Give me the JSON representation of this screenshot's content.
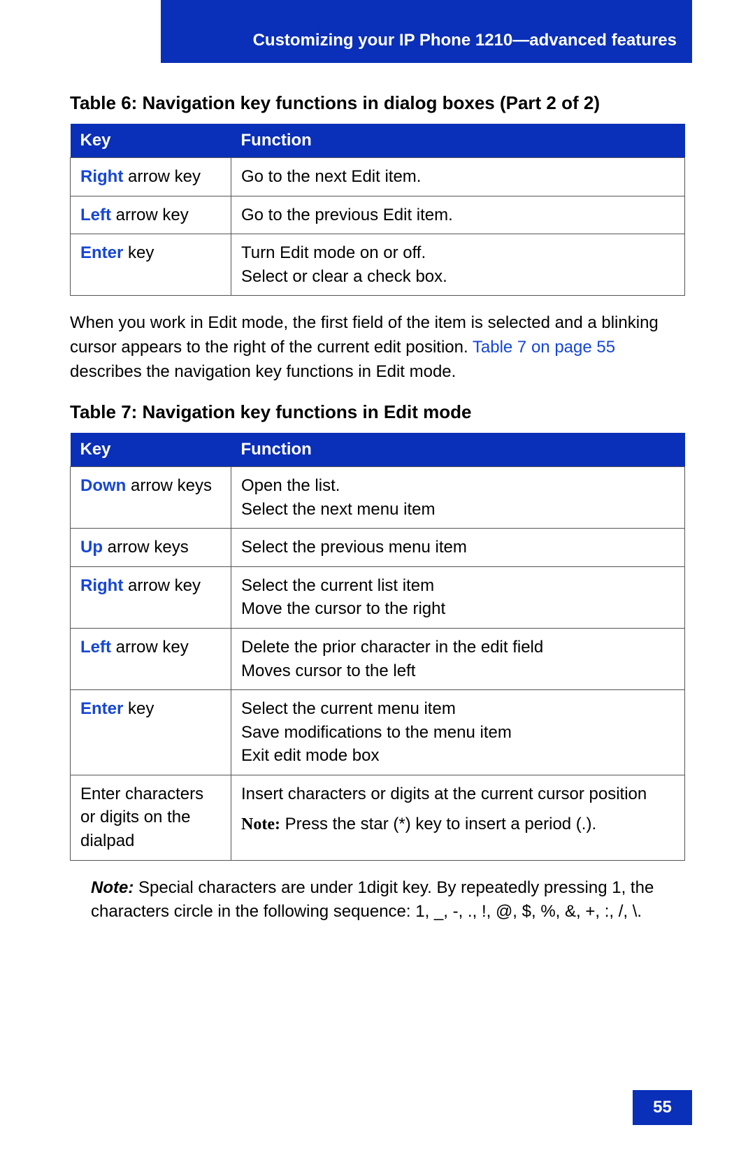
{
  "header": "Customizing your IP Phone 1210—advanced features",
  "table6": {
    "caption": "Table 6: Navigation key functions in dialog boxes (Part 2 of 2)",
    "col1": "Key",
    "col2": "Function",
    "rows": [
      {
        "kb": "Right",
        "kt": " arrow key",
        "fn": "Go to the next Edit item."
      },
      {
        "kb": "Left",
        "kt": " arrow key",
        "fn": "Go to the previous Edit item."
      },
      {
        "kb": "Enter",
        "kt": " key",
        "fn": "Turn Edit mode on or off.\nSelect or clear a check box."
      }
    ]
  },
  "para1a": "When you work in Edit mode, the first field of the item is selected and a blinking cursor appears to the right of the current edit position. ",
  "para1link": "Table 7 on page 55",
  "para1b": " describes the navigation key functions in Edit mode.",
  "table7": {
    "caption": "Table 7: Navigation key functions in Edit mode",
    "col1": "Key",
    "col2": "Function",
    "rows": [
      {
        "kb": "Down",
        "kt": " arrow keys",
        "fn": "Open the list.\nSelect the next menu item"
      },
      {
        "kb": "Up",
        "kt": " arrow keys",
        "fn": "Select the previous menu item"
      },
      {
        "kb": "Right",
        "kt": " arrow key",
        "fn": "Select the current list item\nMove the cursor to the right"
      },
      {
        "kb": "Left",
        "kt": " arrow key",
        "fn": "Delete the prior character in the edit field\nMoves cursor to the left"
      },
      {
        "kb": "Enter",
        "kt": " key",
        "fn": "Select the current menu item\nSave modifications to the menu item\nExit edit mode box"
      }
    ],
    "lastrow": {
      "key": "Enter characters or digits on the dialpad",
      "fn": "Insert characters or digits at the current cursor position",
      "note_label": "Note:",
      "note_text": " Press the star (*) key to insert a period (.)."
    }
  },
  "footnote": {
    "label": "Note:",
    "text": " Special characters are under 1digit key. By repeatedly pressing 1, the characters circle in the following sequence: 1, _, -, ., !, @, $, %, &, +, :, /, \\."
  },
  "page": "55"
}
